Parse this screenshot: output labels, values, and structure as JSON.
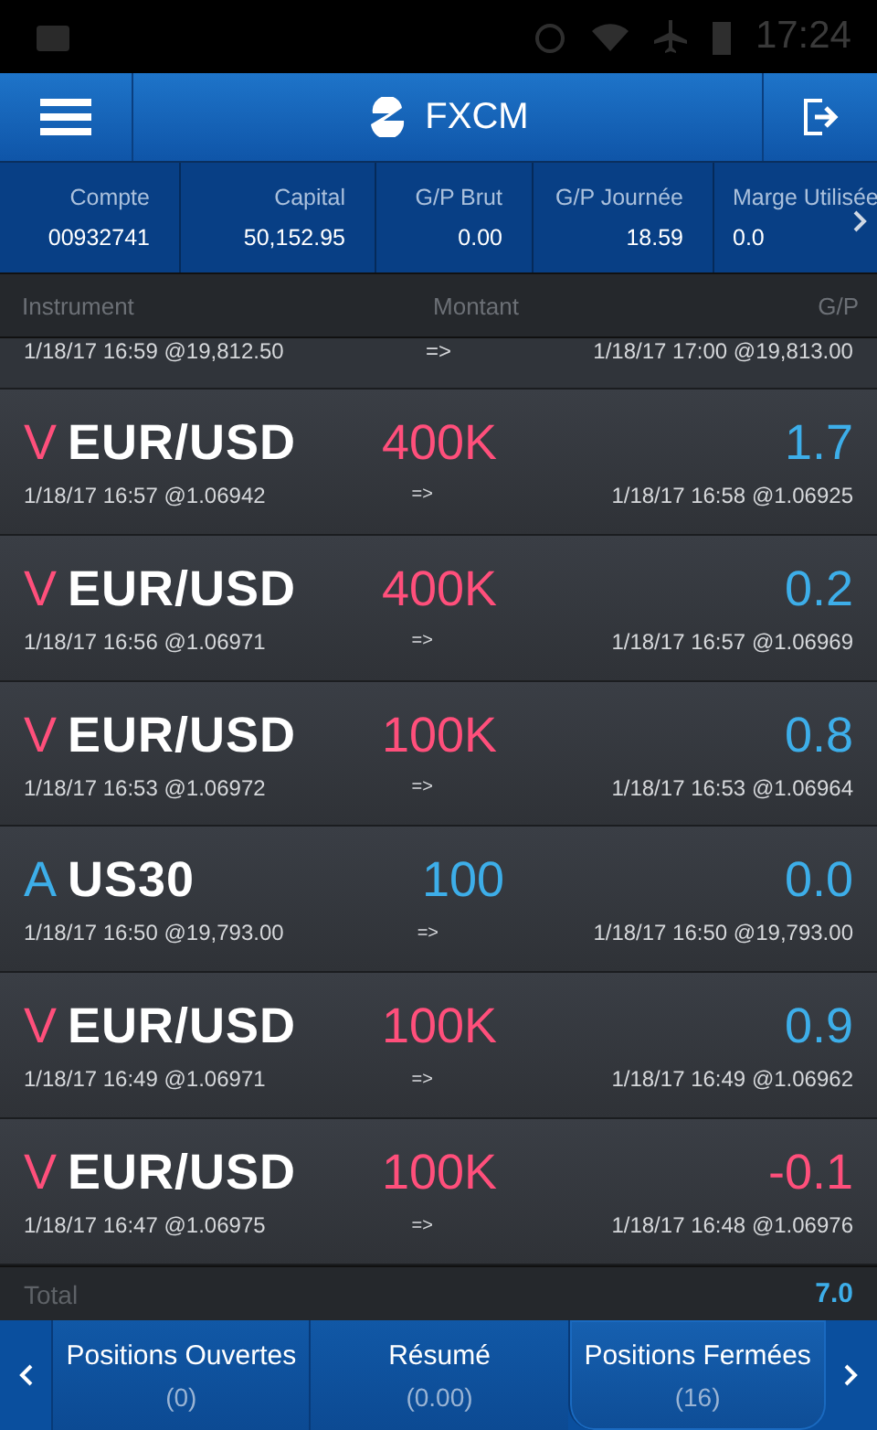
{
  "status_bar": {
    "time": "17:24"
  },
  "header": {
    "title": "FXCM"
  },
  "summary": [
    {
      "label": "Compte",
      "value": "00932741"
    },
    {
      "label": "Capital",
      "value": "50,152.95"
    },
    {
      "label": "G/P Brut",
      "value": "0.00"
    },
    {
      "label": "G/P Journée",
      "value": "18.59"
    },
    {
      "label": "Marge Utilisée",
      "value": "0.0"
    }
  ],
  "columns": [
    "Instrument",
    "Montant",
    "G/P"
  ],
  "partial_row": {
    "open": "1/18/17 16:59 @19,812.50",
    "arrow": "=>",
    "close": "1/18/17 17:00 @19,813.00"
  },
  "rows": [
    {
      "side": "V",
      "kind": "sell",
      "symbol": "EUR/USD",
      "amount": "400K",
      "pl": "1.7",
      "loss": false,
      "open": "1/18/17 16:57 @1.06942",
      "arrow": "=>",
      "close": "1/18/17 16:58 @1.06925"
    },
    {
      "side": "V",
      "kind": "sell",
      "symbol": "EUR/USD",
      "amount": "400K",
      "pl": "0.2",
      "loss": false,
      "open": "1/18/17 16:56 @1.06971",
      "arrow": "=>",
      "close": "1/18/17 16:57 @1.06969"
    },
    {
      "side": "V",
      "kind": "sell",
      "symbol": "EUR/USD",
      "amount": "100K",
      "pl": "0.8",
      "loss": false,
      "open": "1/18/17 16:53 @1.06972",
      "arrow": "=>",
      "close": "1/18/17 16:53 @1.06964"
    },
    {
      "side": "A",
      "kind": "buy",
      "symbol": "US30",
      "amount": "100",
      "pl": "0.0",
      "loss": false,
      "open": "1/18/17 16:50 @19,793.00",
      "arrow": "=>",
      "close": "1/18/17 16:50 @19,793.00"
    },
    {
      "side": "V",
      "kind": "sell",
      "symbol": "EUR/USD",
      "amount": "100K",
      "pl": "0.9",
      "loss": false,
      "open": "1/18/17 16:49 @1.06971",
      "arrow": "=>",
      "close": "1/18/17 16:49 @1.06962"
    },
    {
      "side": "V",
      "kind": "sell",
      "symbol": "EUR/USD",
      "amount": "100K",
      "pl": "-0.1",
      "loss": true,
      "open": "1/18/17 16:47 @1.06975",
      "arrow": "=>",
      "close": "1/18/17 16:48 @1.06976"
    }
  ],
  "total": {
    "label": "Total",
    "value": "7.0"
  },
  "tabs": [
    {
      "label": "Positions Ouvertes",
      "count": "(0)",
      "selected": false
    },
    {
      "label": "Résumé",
      "count": "(0.00)",
      "selected": false
    },
    {
      "label": "Positions Fermées",
      "count": "(16)",
      "selected": true
    }
  ]
}
